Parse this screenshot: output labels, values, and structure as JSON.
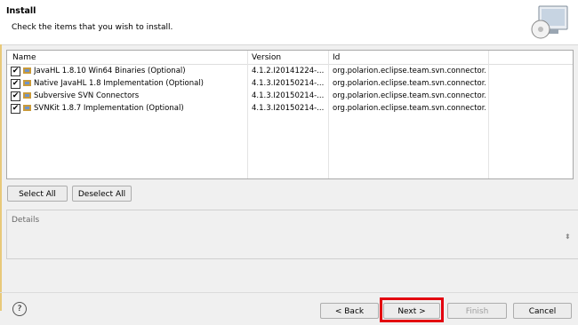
{
  "header": {
    "title": "Install",
    "message": "Check the items that you wish to install."
  },
  "table": {
    "columns": [
      "Name",
      "Version",
      "Id"
    ],
    "rows": [
      {
        "checked": true,
        "name": "JavaHL 1.8.10 Win64 Binaries (Optional)",
        "version": "4.1.2.I20141224-...",
        "id": "org.polarion.eclipse.team.svn.connector...."
      },
      {
        "checked": true,
        "name": "Native JavaHL 1.8 Implementation (Optional)",
        "version": "4.1.3.I20150214-...",
        "id": "org.polarion.eclipse.team.svn.connector...."
      },
      {
        "checked": true,
        "name": "Subversive SVN Connectors",
        "version": "4.1.3.I20150214-...",
        "id": "org.polarion.eclipse.team.svn.connector...."
      },
      {
        "checked": true,
        "name": "SVNKit 1.8.7 Implementation (Optional)",
        "version": "4.1.3.I20150214-...",
        "id": "org.polarion.eclipse.team.svn.connector...."
      }
    ]
  },
  "buttons": {
    "select_all": "Select All",
    "deselect_all": "Deselect All",
    "back": "< Back",
    "next": "Next >",
    "finish": "Finish",
    "cancel": "Cancel"
  },
  "details": {
    "label": "Details"
  },
  "icons": {
    "help": "help-icon",
    "header": "install-cd-icon",
    "feature": "feature-plugin-icon"
  },
  "colors": {
    "highlight": "#e3000f"
  }
}
